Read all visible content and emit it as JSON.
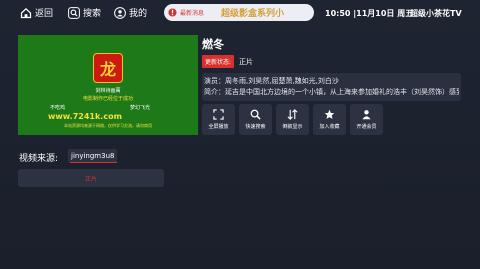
{
  "topbar": {
    "back_label": "返回",
    "search_label": "搜索",
    "mine_label": "我的",
    "news_label": "最新消息",
    "marquee_text": "超级影盒系列小",
    "datetime": "10:50 |11月10日 周五",
    "brand": "超级小茶花TV"
  },
  "poster": {
    "emblem_char": "龙",
    "line1": "剑林诗画萬",
    "line2": "电影制作已经位于成功",
    "left_text": "不吃鸡",
    "right_text": "梦幻飞光",
    "url_text": "www.7241k.com",
    "bottom_text": "本站资源均来源于网络，仅供学习交流，请勿商用"
  },
  "detail": {
    "title": "燃冬",
    "status_tag": "更新状态:",
    "status_value": "正片",
    "cast_line": "演员：周冬雨,刘昊然,屈楚萧,魏如光,刘白沙",
    "synopsis_line": "简介：延吉是中国北方边境的一个小镇，从上海来参加婚礼的浩丰（刘昊然饰）感到..."
  },
  "actions": [
    {
      "label": "全屏播放",
      "icon": "fullscreen-icon"
    },
    {
      "label": "快速搜索",
      "icon": "search-icon"
    },
    {
      "label": "倒叙显示",
      "icon": "sort-icon"
    },
    {
      "label": "加入收藏",
      "icon": "star-icon"
    },
    {
      "label": "开通会员",
      "icon": "vip-icon"
    }
  ],
  "source": {
    "label": "视频来源:",
    "selected": "jinyingm3u8"
  },
  "episodes": [
    {
      "label": "正片"
    }
  ],
  "colors": {
    "background": "#1e2431",
    "accent_red": "#d9302c",
    "marquee_gold": "#d4a03a",
    "panel": "#2c3242"
  }
}
